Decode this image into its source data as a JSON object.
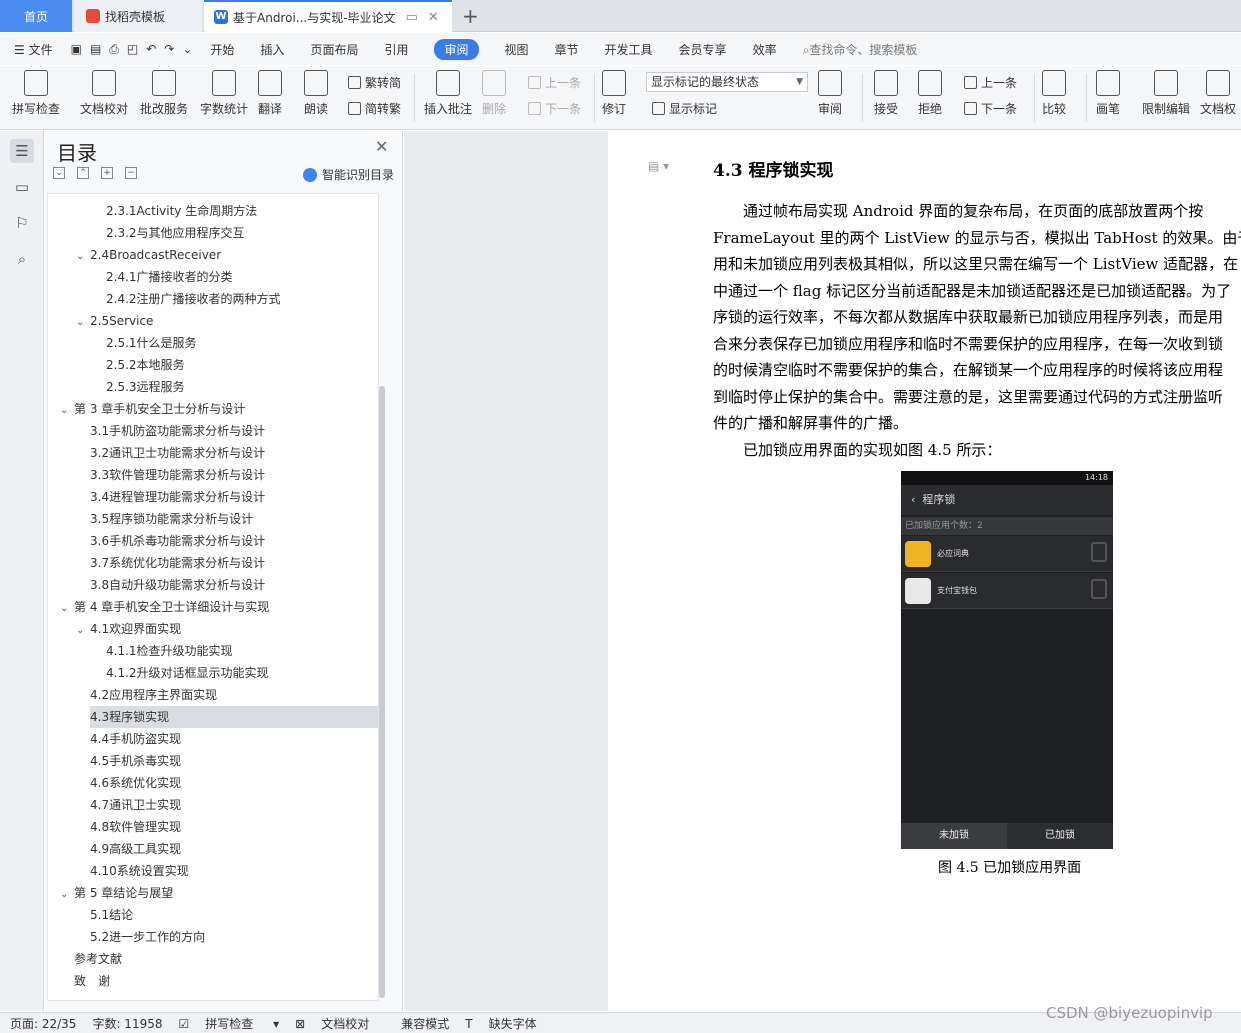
{
  "tabs": {
    "home": "首页",
    "template": "找稻壳模板",
    "document": "基于Androi...与实现-毕业论文"
  },
  "menu": {
    "file": "文件",
    "items": [
      "开始",
      "插入",
      "页面布局",
      "引用",
      "审阅",
      "视图",
      "章节",
      "开发工具",
      "会员专享",
      "效率"
    ],
    "active": "审阅",
    "search_placeholder": "查找命令、搜索模板"
  },
  "ribbon": {
    "spell_check": "拼写检查",
    "doc_proof": "文档校对",
    "batch_service": "批改服务",
    "word_count": "字数统计",
    "translate": "翻译",
    "read_aloud": "朗读",
    "to_traditional": "繁转简",
    "to_simplified": "简转繁",
    "insert_comment": "插入批注",
    "delete": "删除",
    "prev": "上一条",
    "next": "下一条",
    "revise": "修订",
    "markup_state": "显示标记的最终状态",
    "show_markup": "显示标记",
    "review": "审阅",
    "accept": "接受",
    "reject": "拒绝",
    "prev2": "上一条",
    "next2": "下一条",
    "compare": "比较",
    "pen": "画笔",
    "restrict_edit": "限制编辑",
    "doc_rights": "文档权"
  },
  "toc": {
    "title": "目录",
    "smart_label": "智能识别目录",
    "items": [
      {
        "text": "2.3.1Activity 生命周期方法",
        "level": 3
      },
      {
        "text": "2.3.2与其他应用程序交互",
        "level": 3
      },
      {
        "text": "2.4BroadcastReceiver",
        "level": 2,
        "caret": true
      },
      {
        "text": "2.4.1广播接收者的分类",
        "level": 3
      },
      {
        "text": "2.4.2注册广播接收者的两种方式",
        "level": 3
      },
      {
        "text": "2.5Service",
        "level": 2,
        "caret": true
      },
      {
        "text": "2.5.1什么是服务",
        "level": 3
      },
      {
        "text": "2.5.2本地服务",
        "level": 3
      },
      {
        "text": "2.5.3远程服务",
        "level": 3
      },
      {
        "text": "第 3 章手机安全卫士分析与设计",
        "level": 1,
        "caret": true
      },
      {
        "text": "3.1手机防盗功能需求分析与设计",
        "level": 2
      },
      {
        "text": "3.2通讯卫士功能需求分析与设计",
        "level": 2
      },
      {
        "text": "3.3软件管理功能需求分析与设计",
        "level": 2
      },
      {
        "text": "3.4进程管理功能需求分析与设计",
        "level": 2
      },
      {
        "text": "3.5程序锁功能需求分析与设计",
        "level": 2
      },
      {
        "text": "3.6手机杀毒功能需求分析与设计",
        "level": 2
      },
      {
        "text": "3.7系统优化功能需求分析与设计",
        "level": 2
      },
      {
        "text": "3.8自动升级功能需求分析与设计",
        "level": 2
      },
      {
        "text": "第 4 章手机安全卫士详细设计与实现",
        "level": 1,
        "caret": true
      },
      {
        "text": "4.1欢迎界面实现",
        "level": 2,
        "caret": true
      },
      {
        "text": "4.1.1检查升级功能实现",
        "level": 3
      },
      {
        "text": "4.1.2升级对话框显示功能实现",
        "level": 3
      },
      {
        "text": "4.2应用程序主界面实现",
        "level": 2
      },
      {
        "text": "4.3程序锁实现",
        "level": 2,
        "selected": true
      },
      {
        "text": "4.4手机防盗实现",
        "level": 2
      },
      {
        "text": "4.5手机杀毒实现",
        "level": 2
      },
      {
        "text": "4.6系统优化实现",
        "level": 2
      },
      {
        "text": "4.7通讯卫士实现",
        "level": 2
      },
      {
        "text": "4.8软件管理实现",
        "level": 2
      },
      {
        "text": "4.9高级工具实现",
        "level": 2
      },
      {
        "text": "4.10系统设置实现",
        "level": 2
      },
      {
        "text": "第 5 章结论与展望",
        "level": 1,
        "caret": true
      },
      {
        "text": "5.1结论",
        "level": 2
      },
      {
        "text": "5.2进一步工作的方向",
        "level": 2
      },
      {
        "text": "参考文献",
        "level": 1
      },
      {
        "text": "致　谢",
        "level": 1
      }
    ]
  },
  "document": {
    "heading": "4.3  程序锁实现",
    "lines": [
      "　　通过帧布局实现 Android 界面的复杂布局，在页面的底部放置两个按",
      "FrameLayout 里的两个 ListView 的显示与否，模拟出 TabHost 的效果。由于已",
      "用和未加锁应用列表极其相似，所以这里只需在编写一个 ListView 适配器，在",
      "中通过一个 flag 标记区分当前适配器是未加锁适配器还是已加锁适配器。为了",
      "序锁的运行效率，不每次都从数据库中获取最新已加锁应用程序列表，而是用",
      "合来分表保存已加锁应用程序和临时不需要保护的应用程序，在每一次收到锁",
      "的时候清空临时不需要保护的集合，在解锁某一个应用程序的时候将该应用程",
      "到临时停止保护的集合中。需要注意的是，这里需要通过代码的方式注册监听",
      "件的广播和解屏事件的广播。",
      "　　已加锁应用界面的实现如图 4.5 所示："
    ],
    "caption": "图 4.5 已加锁应用界面"
  },
  "phone": {
    "time": "14:18",
    "title": "程序锁",
    "count": "已加锁应用个数：2",
    "apps": [
      {
        "name": "必应词典",
        "color": "#f0b323"
      },
      {
        "name": "支付宝钱包",
        "color": "#e8e8e8"
      }
    ],
    "tab_unlocked": "未加锁",
    "tab_locked": "已加锁"
  },
  "status": {
    "page": "页面: 22/35",
    "words": "字数: 11958",
    "spell": "拼写检查",
    "proof": "文档校对",
    "compat": "兼容模式",
    "missing_font": "缺失字体"
  },
  "watermark": "CSDN @biyezuopinvip"
}
